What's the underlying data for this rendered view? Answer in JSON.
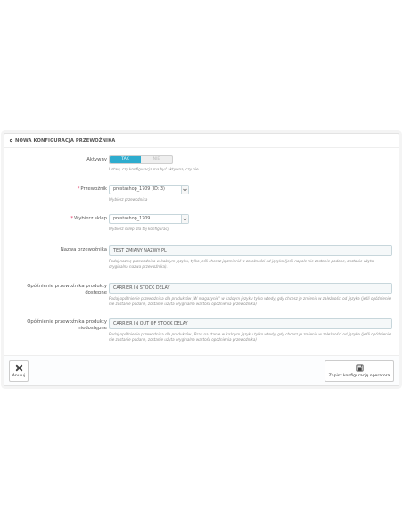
{
  "panel": {
    "title": "NOWA KONFIGURACJA PRZEWOŹNIKA"
  },
  "active": {
    "label": "Aktywny",
    "yes": "TAK",
    "no": "NIE",
    "help": "Ustaw, czy konfiguracja ma być aktywna, czy nie"
  },
  "carrier": {
    "label": "Przewoźnik",
    "value": "prestashop_1709 (ID: 3)",
    "help": "Wybierz przewoźnika"
  },
  "shop": {
    "label": "Wybierz sklep",
    "value": "prestashop_1709",
    "help": "Wybierz sklep dla tej konfiguracji"
  },
  "carrier_name": {
    "label": "Nazwa przewoźnika",
    "value": "TEST ZMIANY NAZWY PL",
    "help": "Podaj nazwę przewoźnika w każdym języku, tylko jeśli chcesz ją zmienić w zależności od języka (jeśli napole nie zostanie podane, zostanie użyta oryginalna nazwa przewoźnika)."
  },
  "delay_in_stock": {
    "label": "Opóźnienie przewoźnika produkty dostępne",
    "value": "CARRIER IN STOCK DELAY",
    "help": "Podaj opóźnienie przewoźnika dla produktów „W magazynie\" w każdym języku tylko wtedy, gdy chcesz je zmienić w zależności od języka (jeśli opóźnienie nie zostanie podane, zostanie użyta oryginalna wartość opóźnienia przewoźnika)"
  },
  "delay_out_stock": {
    "label": "Opóźnienie przewoźnika produkty niedostępne",
    "value": "CARRIER IN OUT OF STOCK DELAY",
    "help": "Podaj opóźnienie przewoźnika dla produktów „Brak na stanie w każdym języku tylko wtedy, gdy chcesz je zmienić w zależności od języka (jeśli opóźnienie nie zostanie podane, zostanie użyta oryginalna wartość opóźnienia przewoźnika)"
  },
  "footer": {
    "cancel": "Anuluj",
    "save": "Zapisz konfigurację operatora"
  },
  "colors": {
    "accent": "#2eacce",
    "required": "#e0305f"
  }
}
